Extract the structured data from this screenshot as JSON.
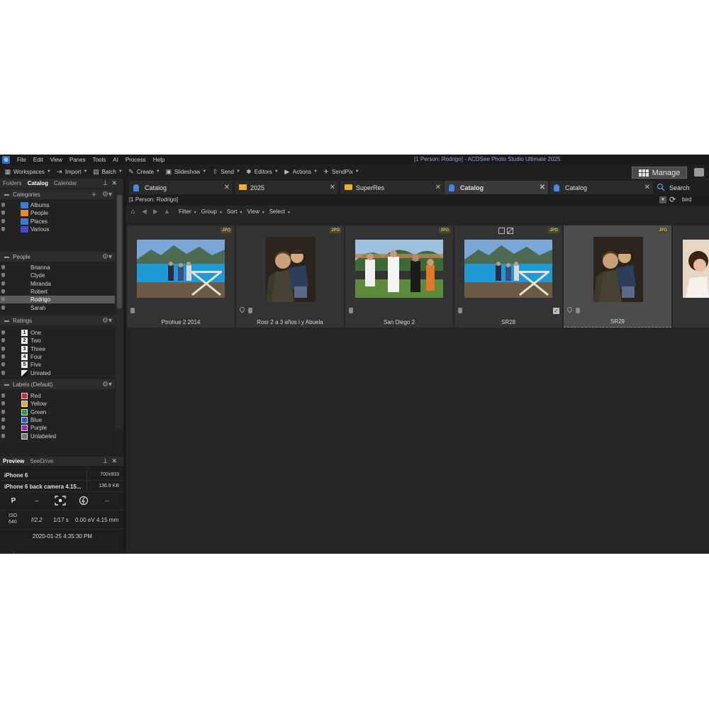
{
  "menubar": {
    "items": [
      "File",
      "Edit",
      "View",
      "Panes",
      "Tools",
      "AI",
      "Process",
      "Help"
    ],
    "title": "[1 Person: Rodrigo] - ACDSee Photo Studio Ultimate 2025"
  },
  "toolbar": {
    "items": [
      "Workspaces",
      "Import",
      "Batch",
      "Create",
      "Slideshow",
      "Send",
      "Editors",
      "Actions",
      "SendPix"
    ],
    "manage": "Manage"
  },
  "left_panel": {
    "tabs": [
      "Folders",
      "Catalog",
      "Calendar"
    ],
    "categories_title": "Categories",
    "categories": [
      {
        "label": "Albums",
        "color": "#3b7bd4"
      },
      {
        "label": "People",
        "color": "#e8863a"
      },
      {
        "label": "Places",
        "color": "#3b7bd4"
      },
      {
        "label": "Various",
        "color": "#4a4ad0"
      }
    ],
    "people_title": "People",
    "people": [
      "Brianna",
      "Clyde",
      "Miranda",
      "Robert",
      "Rodrigo",
      "Sarah"
    ],
    "selected_person": "Rodrigo",
    "ratings_title": "Ratings",
    "ratings": [
      {
        "box": "1",
        "label": "One"
      },
      {
        "box": "2",
        "label": "Two"
      },
      {
        "box": "3",
        "label": "Three"
      },
      {
        "box": "4",
        "label": "Four"
      },
      {
        "box": "5",
        "label": "Five"
      },
      {
        "box": "",
        "label": "Unrated"
      }
    ],
    "labels_title": "Labels (Default)",
    "labels": [
      {
        "label": "Red",
        "color": "#d42a2a"
      },
      {
        "label": "Yellow",
        "color": "#e8a82a"
      },
      {
        "label": "Green",
        "color": "#2a9a3a"
      },
      {
        "label": "Blue",
        "color": "#2a5ad4"
      },
      {
        "label": "Purple",
        "color": "#9a2ab4"
      },
      {
        "label": "Unlabeled",
        "color": "#777777"
      }
    ]
  },
  "preview": {
    "tabs": [
      "Preview",
      "SeeDrive"
    ],
    "camera": "iPhone 6",
    "dimensions": "700x933",
    "lens": "iPhone 6 back camera 4.15...",
    "filesize": "136.9 KB",
    "mode": "P",
    "dash1": "--",
    "dash2": "--",
    "iso_label": "ISO",
    "iso_value": "640",
    "aperture": "f/2.2",
    "shutter": "1/17 s",
    "exposure": "0.00 eV",
    "focal": "4.15 mm",
    "datetime": "2020-01-25 4:35:30 PM"
  },
  "tabs": [
    {
      "label": "Catalog",
      "type": "catalog",
      "active": false
    },
    {
      "label": "2025",
      "type": "folder",
      "active": false
    },
    {
      "label": "SuperRes",
      "type": "folder",
      "active": false
    },
    {
      "label": "Catalog",
      "type": "catalog",
      "active": true
    },
    {
      "label": "Catalog",
      "type": "catalog",
      "active": false
    }
  ],
  "search_tab": "Search",
  "path": {
    "text": "[1 Person: Rodrigo]",
    "search_value": "bird"
  },
  "nav_menus": [
    "Filter",
    "Group",
    "Sort",
    "View",
    "Select"
  ],
  "thumbnails": [
    {
      "caption": "Ptrohue 2 2014",
      "badge": "JPG",
      "kind": "lake",
      "has_pin": false,
      "checked": false,
      "selected": false
    },
    {
      "caption": "Rosr 2 a 3 años i y Abuela",
      "badge": "JPG",
      "kind": "portrait",
      "has_pin": true,
      "checked": false,
      "selected": false
    },
    {
      "caption": "San Diego 2",
      "badge": "JPG",
      "kind": "group",
      "has_pin": false,
      "checked": false,
      "selected": false
    },
    {
      "caption": "SR28",
      "badge": "JPG",
      "kind": "lake",
      "has_pin": false,
      "checked": true,
      "selected": false
    },
    {
      "caption": "SR29",
      "badge": "JPG",
      "kind": "portrait",
      "has_pin": true,
      "checked": false,
      "selected": true
    }
  ]
}
